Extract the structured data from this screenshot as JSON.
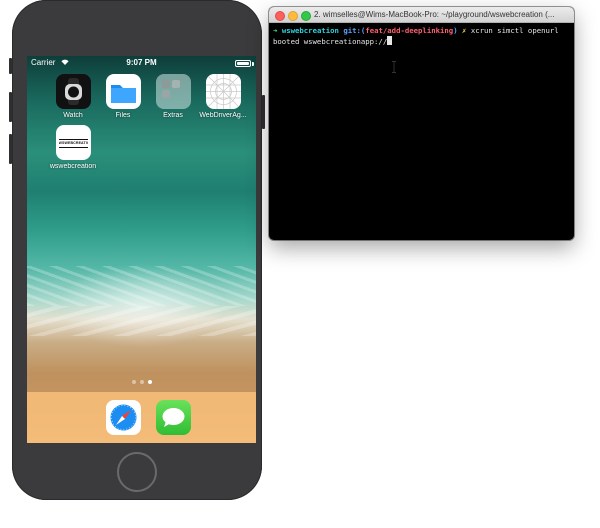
{
  "phone": {
    "status": {
      "carrier": "Carrier",
      "time": "9:07 PM"
    },
    "apps": [
      {
        "label": "Watch",
        "icon": "watch-icon"
      },
      {
        "label": "Files",
        "icon": "files-icon"
      },
      {
        "label": "Extras",
        "icon": "extras-folder-icon"
      },
      {
        "label": "WebDriverAg...",
        "icon": "webdriveragent-icon"
      },
      {
        "label": "wswebcreation",
        "icon": "wswebcreation-icon",
        "icon_text": "WSWEBCREATION"
      }
    ],
    "page_dots": {
      "count": 3,
      "active": 2
    },
    "dock": [
      {
        "icon": "safari-icon"
      },
      {
        "icon": "messages-icon"
      }
    ]
  },
  "terminal": {
    "title": "2. wimselles@Wims-MacBook-Pro: ~/playground/wswebcreation (...",
    "prompt": {
      "arrow": "➜",
      "dir": "wswebcreation",
      "git_prefix": "git:(",
      "branch": "feat/add-deeplinking",
      "git_suffix": ")",
      "dirty": "✗",
      "command": "xcrun simctl openurl"
    },
    "line2": "booted wswebcreationapp://"
  },
  "colors": {
    "phone_body": "#3b3a3c",
    "dock": "#f5bc78",
    "terminal_bg": "#000000",
    "prompt_arrow": "#3ee07a",
    "prompt_dir": "#2bd3df",
    "prompt_git": "#5aa2ff",
    "prompt_branch": "#ff5f6e",
    "prompt_dirty": "#e8d44d"
  }
}
